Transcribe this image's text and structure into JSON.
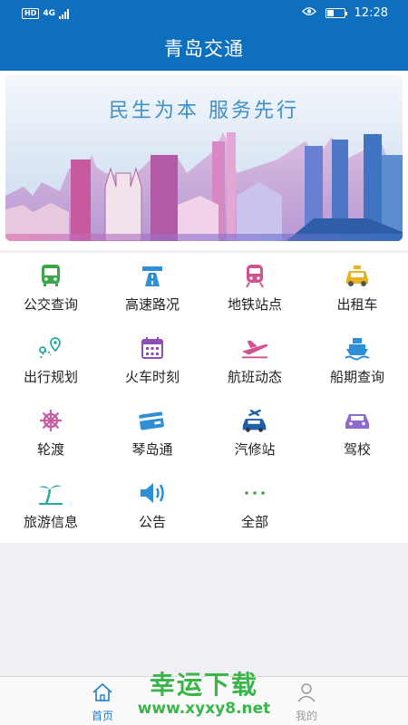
{
  "status_bar": {
    "network_hd": "HD",
    "network_4g": "4G",
    "time": "12:28"
  },
  "header": {
    "title": "青岛交通"
  },
  "banner": {
    "slogan": "民生为本   服务先行"
  },
  "services": [
    {
      "label": "公交查询",
      "icon": "bus-icon",
      "color": "#3aa54a"
    },
    {
      "label": "高速路况",
      "icon": "highway-icon",
      "color": "#2e8fd6"
    },
    {
      "label": "地铁站点",
      "icon": "metro-icon",
      "color": "#d1538f"
    },
    {
      "label": "出租车",
      "icon": "taxi-icon",
      "color": "#e9b21f"
    },
    {
      "label": "出行规划",
      "icon": "route-plan-icon",
      "color": "#2aa8a0"
    },
    {
      "label": "火车时刻",
      "icon": "calendar-icon",
      "color": "#8d4fb3"
    },
    {
      "label": "航班动态",
      "icon": "airplane-icon",
      "color": "#d1538f"
    },
    {
      "label": "船期查询",
      "icon": "ship-icon",
      "color": "#2e8fd6"
    },
    {
      "label": "轮渡",
      "icon": "ship-wheel-icon",
      "color": "#c95fa6"
    },
    {
      "label": "琴岛通",
      "icon": "card-icon",
      "color": "#2e8fd6"
    },
    {
      "label": "汽修站",
      "icon": "car-repair-icon",
      "color": "#1e5fa8"
    },
    {
      "label": "驾校",
      "icon": "car-icon",
      "color": "#8d6ad1"
    },
    {
      "label": "旅游信息",
      "icon": "palm-tree-icon",
      "color": "#2aa8a0"
    },
    {
      "label": "公告",
      "icon": "speaker-icon",
      "color": "#2e8fd6"
    },
    {
      "label": "全部",
      "icon": "more-dots-icon",
      "color": "#3aa54a"
    }
  ],
  "bottom_nav": {
    "home": {
      "label": "首页",
      "icon": "home-icon",
      "color": "#1f7ccf"
    },
    "mine": {
      "label": "我的",
      "icon": "user-icon",
      "color": "#999999"
    }
  },
  "watermark": {
    "line1": "幸运下载",
    "line2": "www.xyxy8.net"
  }
}
